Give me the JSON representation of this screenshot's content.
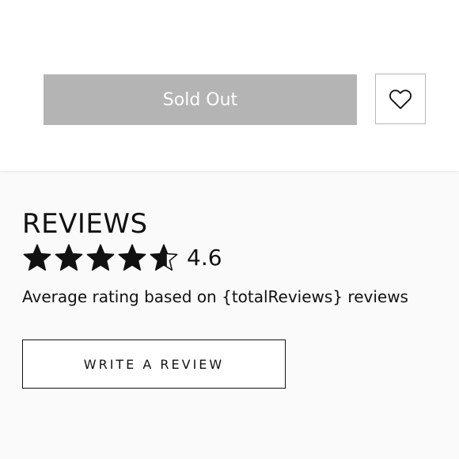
{
  "purchase": {
    "sold_out_label": "Sold Out",
    "wishlist_icon": "heart-outline-icon"
  },
  "reviews": {
    "title": "REVIEWS",
    "rating": "4.6",
    "stars_filled": 4.6,
    "stars_total": 5,
    "average_text": "Average rating based on {totalReviews} reviews",
    "write_review_label": "WRITE A REVIEW",
    "star_color": "#111111"
  },
  "colors": {
    "sold_out_bg": "#b4b4b4",
    "page_bg": "#fafafa",
    "panel_bg": "#ffffff"
  }
}
